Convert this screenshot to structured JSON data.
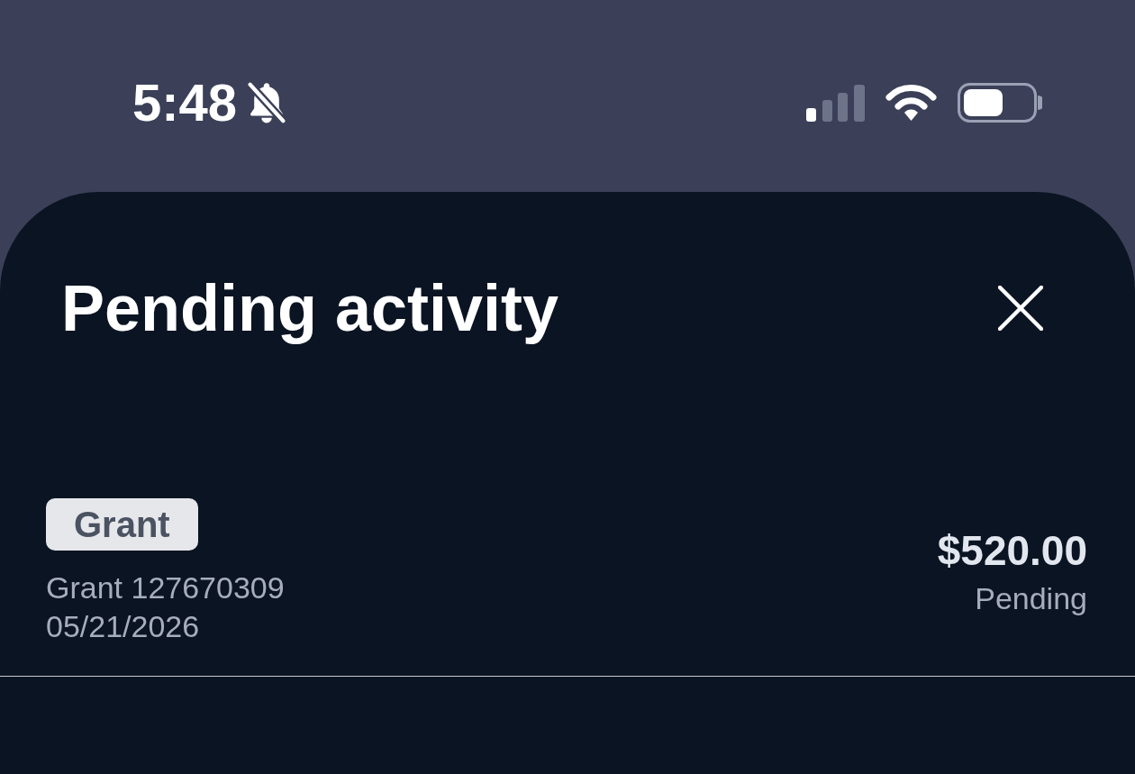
{
  "status_bar": {
    "time": "5:48",
    "silent": true
  },
  "sheet": {
    "title": "Pending activity"
  },
  "transactions": [
    {
      "tag": "Grant",
      "description": "Grant 127670309",
      "date": "05/21/2026",
      "amount": "$520.00",
      "status": "Pending"
    }
  ]
}
